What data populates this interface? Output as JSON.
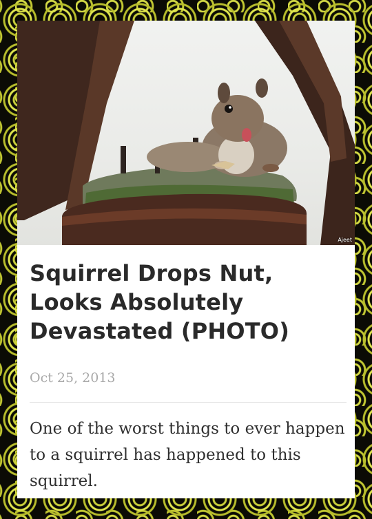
{
  "article": {
    "photo_credit": "Ajeet",
    "title": "Squirrel Drops Nut, Looks Absolutely Devastated (PHOTO)",
    "date": "Oct 25, 2013",
    "summary": "One of the worst things to ever happen to a squirrel has happened to this squirrel."
  },
  "colors": {
    "background_pattern": "#c9cf3a",
    "card": "#ffffff",
    "title_text": "#2a2a2a",
    "date_text": "#a9a9a9",
    "rusty_metal": "#4a2e22"
  }
}
